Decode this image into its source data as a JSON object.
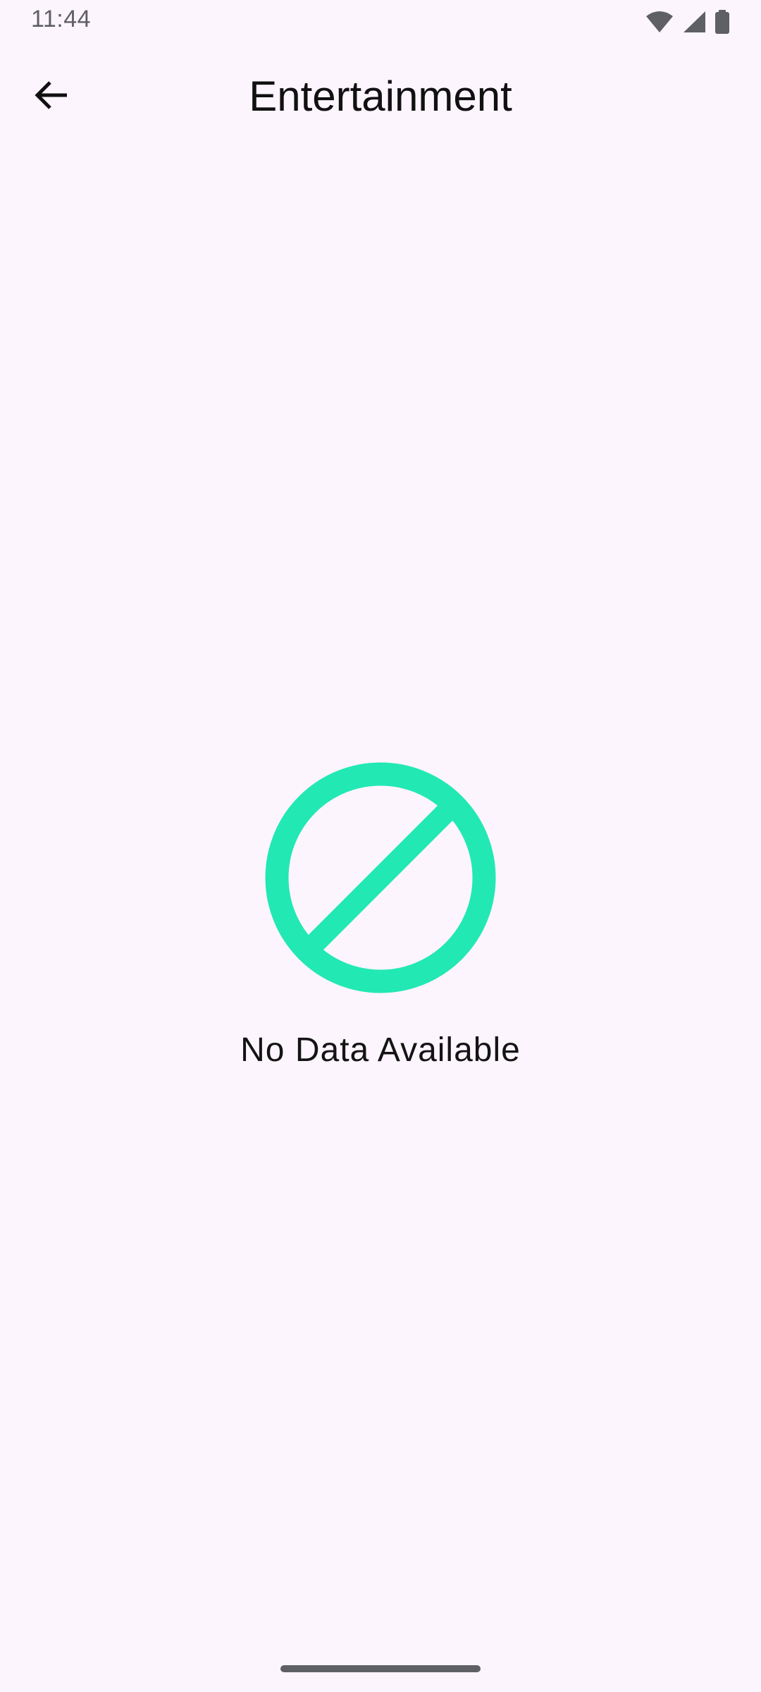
{
  "status_bar": {
    "time": "11:44",
    "icons": [
      "wifi-icon",
      "cellular-signal-icon",
      "battery-icon"
    ]
  },
  "app_bar": {
    "back_icon": "arrow-back-icon",
    "title": "Entertainment"
  },
  "empty_state": {
    "icon": "no-data-prohibited-icon",
    "message": "No Data Available",
    "accent_color": "#22e8b4"
  },
  "colors": {
    "background": "#fcf5fd",
    "status_gray": "#5f5f66"
  }
}
